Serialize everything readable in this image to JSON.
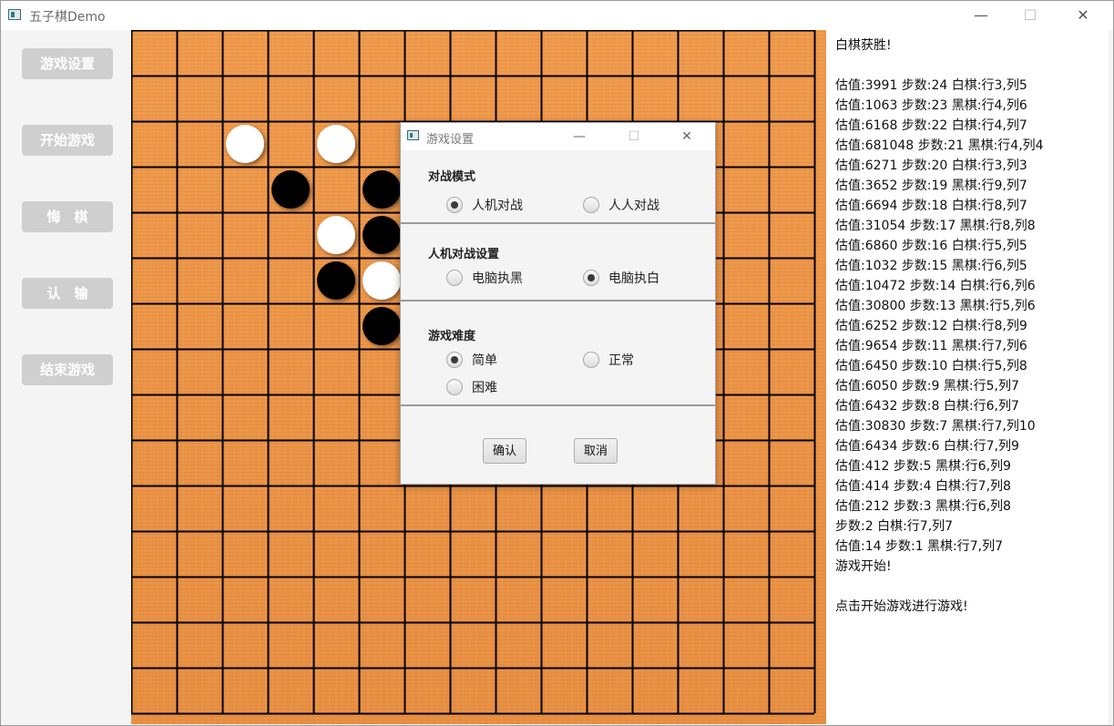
{
  "window": {
    "title": "五子棋Demo",
    "minimize": "—",
    "maximize": "☐",
    "close": "✕"
  },
  "sidebar": {
    "items": [
      {
        "label": "游戏设置"
      },
      {
        "label": "开始游戏"
      },
      {
        "label": "悔　棋"
      },
      {
        "label": "认　输"
      },
      {
        "label": "结束游戏"
      }
    ]
  },
  "board": {
    "size": 15,
    "stones": [
      {
        "row": 2,
        "col": 2,
        "color": "white"
      },
      {
        "row": 2,
        "col": 4,
        "color": "white"
      },
      {
        "row": 3,
        "col": 3,
        "color": "black"
      },
      {
        "row": 3,
        "col": 5,
        "color": "black"
      },
      {
        "row": 4,
        "col": 4,
        "color": "white"
      },
      {
        "row": 4,
        "col": 5,
        "color": "black"
      },
      {
        "row": 5,
        "col": 4,
        "color": "black"
      },
      {
        "row": 5,
        "col": 5,
        "color": "white"
      },
      {
        "row": 6,
        "col": 5,
        "color": "black"
      }
    ]
  },
  "log": {
    "lines": [
      "白棋获胜!",
      "",
      "估值:3991 步数:24 白棋:行3,列5",
      "估值:1063 步数:23 黑棋:行4,列6",
      "估值:6168 步数:22 白棋:行4,列7",
      "估值:681048 步数:21 黑棋:行4,列4",
      "估值:6271 步数:20 白棋:行3,列3",
      "估值:3652 步数:19 黑棋:行9,列7",
      "估值:6694 步数:18 白棋:行8,列7",
      "估值:31054 步数:17 黑棋:行8,列8",
      "估值:6860 步数:16 白棋:行5,列5",
      "估值:1032 步数:15 黑棋:行6,列5",
      "估值:10472 步数:14 白棋:行6,列6",
      "估值:30800 步数:13 黑棋:行5,列6",
      "估值:6252 步数:12 白棋:行8,列9",
      "估值:9654 步数:11 黑棋:行7,列6",
      "估值:6450 步数:10 白棋:行5,列8",
      "估值:6050 步数:9 黑棋:行5,列7",
      "估值:6432 步数:8 白棋:行6,列7",
      "估值:30830 步数:7 黑棋:行7,列10",
      "估值:6434 步数:6 白棋:行7,列9",
      "估值:412 步数:5 黑棋:行6,列9",
      "估值:414 步数:4 白棋:行7,列8",
      "估值:212 步数:3 黑棋:行6,列8",
      "步数:2 白棋:行7,列7",
      "估值:14 步数:1 黑棋:行7,列7",
      "游戏开始!",
      "",
      "点击开始游戏进行游戏!"
    ]
  },
  "dialog": {
    "title": "游戏设置",
    "minimize": "—",
    "maximize": "☐",
    "close": "✕",
    "mode": {
      "title": "对战模式",
      "options": [
        {
          "label": "人机对战",
          "selected": true
        },
        {
          "label": "人人对战",
          "selected": false
        }
      ]
    },
    "ai": {
      "title": "人机对战设置",
      "options": [
        {
          "label": "电脑执黑",
          "selected": false
        },
        {
          "label": "电脑执白",
          "selected": true
        }
      ]
    },
    "difficulty": {
      "title": "游戏难度",
      "options": [
        {
          "label": "简单",
          "selected": true
        },
        {
          "label": "正常",
          "selected": false
        },
        {
          "label": "困难",
          "selected": false
        }
      ]
    },
    "confirm_label": "确认",
    "cancel_label": "取消"
  }
}
